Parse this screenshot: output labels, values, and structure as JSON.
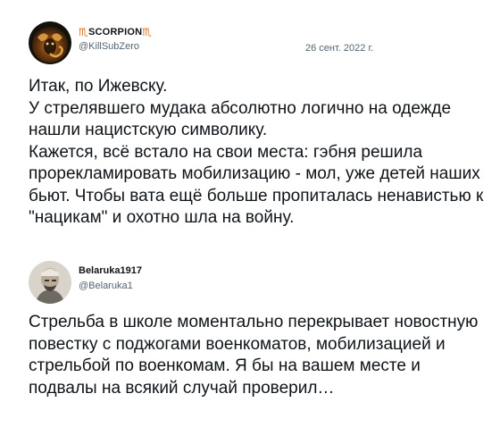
{
  "tweets": [
    {
      "display_name": "SCORPION",
      "name_emoji_left": "♏",
      "name_emoji_right": "♏",
      "handle": "@KillSubZero",
      "date": "26 сент. 2022 г.",
      "text": "Итак, по Ижевску.\nУ стрелявшего мудака абсолютно логично на одежде нашли нацистскую символику.\nКажется, всё встало на свои места: гэбня решила прорекламировать мобилизацию - мол, уже детей наших бьют. Чтобы вата ещё больше пропиталась ненавистью к \"нацикам\" и охотно шла на войну."
    },
    {
      "display_name": "Belaruka1917",
      "handle": "@Belaruka1",
      "text": "Стрельба в школе моментально перекрывает новостную повестку с поджогами военкоматов, мобилизацией и стрельбой по военкомам. Я бы на вашем месте и подвалы на всякий случай проверил…"
    }
  ],
  "colors": {
    "text": "#0f1419",
    "secondary": "#536471",
    "emoji": "#e0701a"
  },
  "icons": {
    "avatar_1": "scorpion-avatar-icon",
    "avatar_2": "man-portrait-avatar-icon"
  }
}
